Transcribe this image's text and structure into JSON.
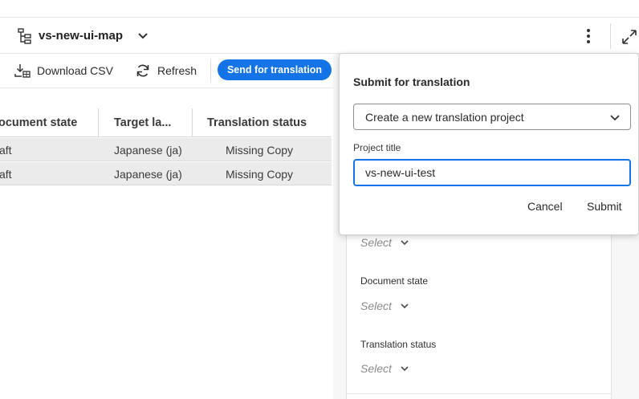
{
  "header": {
    "map_title": "vs-new-ui-map"
  },
  "toolbar": {
    "download_label": "Download CSV",
    "refresh_label": "Refresh",
    "send_label": "Send for translation"
  },
  "table": {
    "columns": [
      "ocument state",
      "Target la...",
      "Translation status"
    ],
    "rows": [
      [
        "aft",
        "Japanese (ja)",
        "Missing Copy"
      ],
      [
        "aft",
        "Japanese (ja)",
        "Missing Copy"
      ]
    ]
  },
  "filters": {
    "top_select_value": "Select",
    "document_state_label": "Document state",
    "document_state_value": "Select",
    "translation_status_label": "Translation status",
    "translation_status_value": "Select"
  },
  "popover": {
    "title": "Submit for translation",
    "project_option": "Create a new translation project",
    "project_title_label": "Project title",
    "project_title_value": "vs-new-ui-test",
    "cancel_label": "Cancel",
    "submit_label": "Submit"
  },
  "colors": {
    "accent": "#1473e6",
    "row_bg": "#ebebeb"
  },
  "icons": {
    "map": "map-tree-icon",
    "chevron": "chevron-down-icon",
    "more": "more-vertical-icon",
    "expand": "expand-icon",
    "download": "download-csv-icon",
    "refresh": "refresh-icon"
  }
}
